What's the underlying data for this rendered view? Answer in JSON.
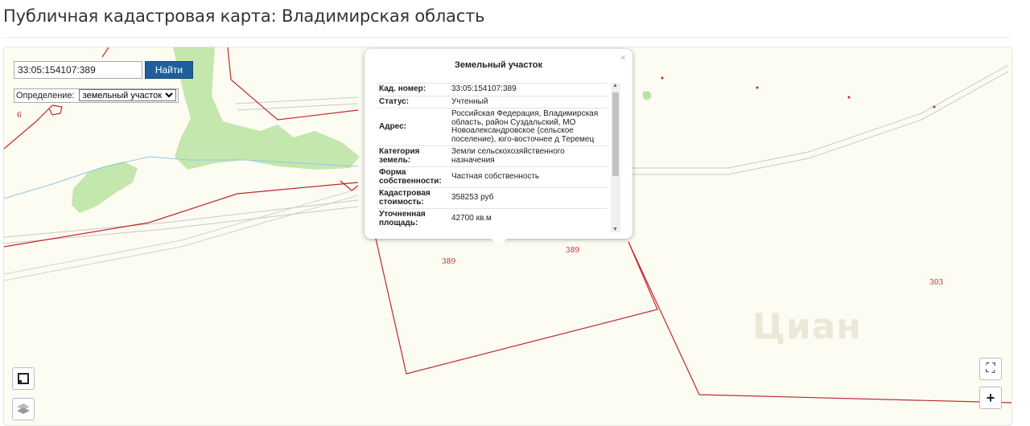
{
  "page": {
    "title": "Публичная кадастровая карта: Владимирская область"
  },
  "search": {
    "value": "33:05:154107:389",
    "button_label": "Найти"
  },
  "definition": {
    "label": "Определение:",
    "selected": "земельный участок"
  },
  "popup": {
    "title": "Земельный участок",
    "close": "×",
    "rows": [
      {
        "key": "Кад. номер:",
        "value": "33:05:154107:389"
      },
      {
        "key": "Статус:",
        "value": "Учтенный"
      },
      {
        "key": "Адрес:",
        "value": "Российская Федерация, Владимирская область, район Суздальский, МО Новоалександровское (сельское поселение), юго-восточнее д Теремец"
      },
      {
        "key": "Категория земель:",
        "value": "Земли сельскохозяйственного назначения"
      },
      {
        "key": "Форма собственности:",
        "value": "Частная собственность"
      },
      {
        "key": "Кадастровая стоимость:",
        "value": "358253 руб"
      },
      {
        "key": "Уточненная площадь:",
        "value": "42700 кв.м"
      }
    ]
  },
  "map_labels": {
    "l1": "389",
    "l2": "389",
    "l3": "303",
    "l4": "6"
  },
  "watermark": "Циан",
  "controls": {
    "fullscreen": "⛶",
    "zoom_in": "+",
    "layers_icon": "layers-icon",
    "select_icon": "square-icon"
  },
  "colors": {
    "parcel_line": "#c0282d",
    "forest": "#b9e3a0",
    "map_bg": "#fdfcf2",
    "button": "#1f5f9d"
  }
}
